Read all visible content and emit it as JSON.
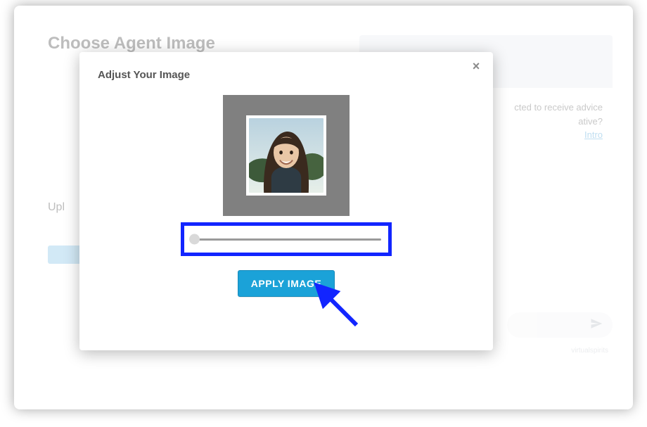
{
  "background": {
    "heading": "Choose Agent Image",
    "upload_label": "Upl",
    "chat_text_line1": "cted to receive advice",
    "chat_text_line2": "ative?",
    "chat_link": "Intro",
    "chat_brand": "virtualspirits"
  },
  "modal": {
    "title": "Adjust Your Image",
    "apply_label": "APPLY IMAGE",
    "close_label": "×"
  }
}
